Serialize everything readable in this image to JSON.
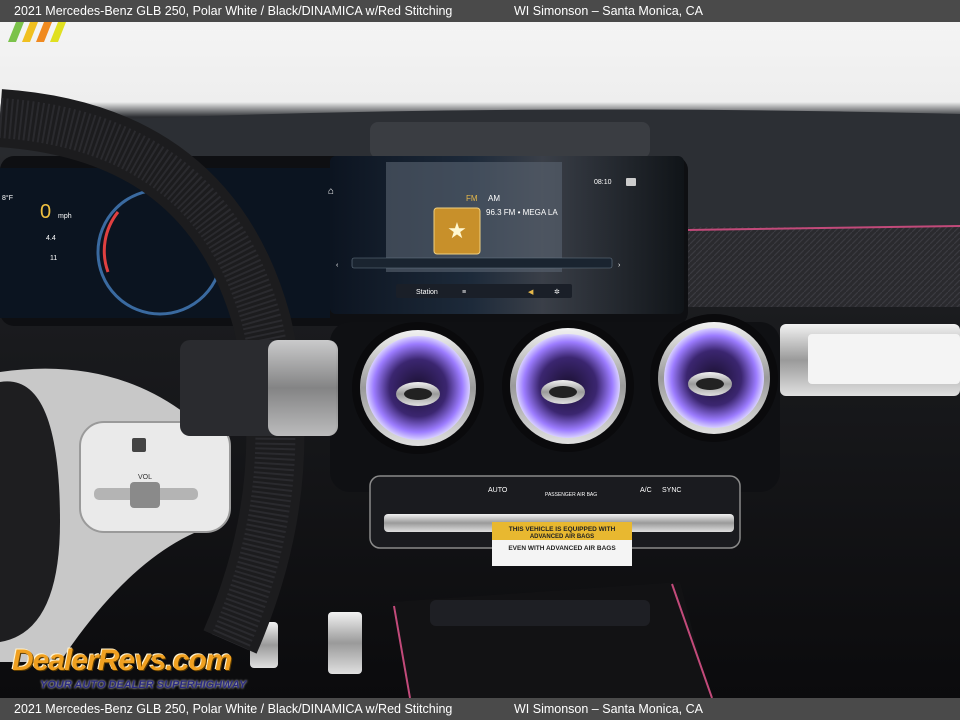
{
  "caption": {
    "title": "2021 Mercedes-Benz GLB 250,  Polar White / Black/DINAMICA w/Red Stitching",
    "dealer": "WI Simonson – Santa Monica, CA"
  },
  "cluster": {
    "speed": "0",
    "speed_unit": "mph",
    "temp": "8°F",
    "readout_a": "4.4",
    "readout_b": "11"
  },
  "infotainment": {
    "band_fm": "FM",
    "band_am": "AM",
    "station": "96.3 FM • MEGA LA",
    "time": "08:10",
    "station_button": "Station"
  },
  "climate_panel": {
    "labels": [
      "AUTO",
      "A/C",
      "SYNC"
    ],
    "passenger_airbag": "PASSENGER AIR BAG"
  },
  "airbag_sticker": {
    "line1": "THIS VEHICLE IS EQUIPPED WITH",
    "line2": "ADVANCED AIR BAGS",
    "line3": "EVEN WITH ADVANCED AIR BAGS"
  },
  "steering_wheel": {
    "vol_label": "VOL"
  },
  "watermark": {
    "logo": "DealerRevs.com",
    "tagline": "YOUR AUTO DEALER SUPERHIGHWAY"
  },
  "colors": {
    "caption_bar": "#4a4a4a",
    "vent_glow": "#8a5cff",
    "dash_accent": "#c24a7a"
  }
}
